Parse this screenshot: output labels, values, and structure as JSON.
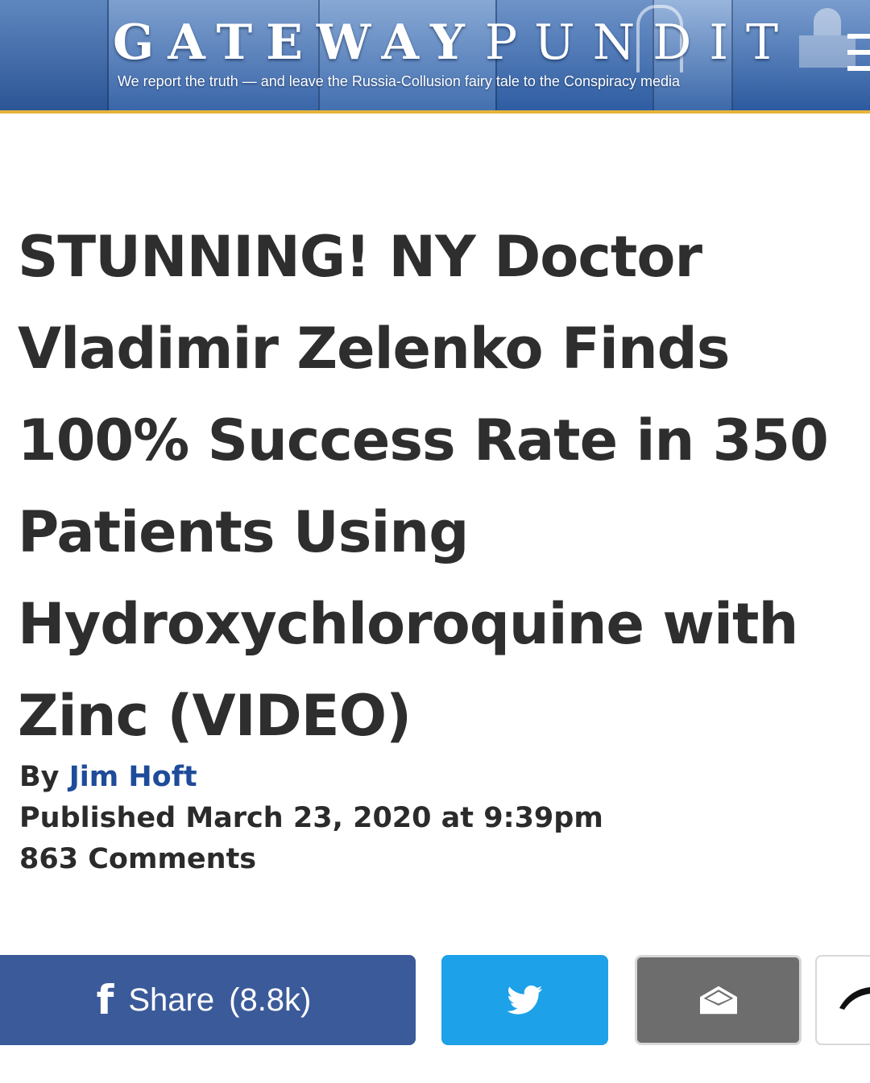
{
  "header": {
    "brand_word1": "GATEWAY",
    "brand_word2": "PUNDIT",
    "tagline": "We report the truth — and leave the Russia-Collusion fairy tale to the Conspiracy media",
    "menu_icon": "hamburger-menu-icon",
    "colors": {
      "banner": "#2a5ca6",
      "accent_border": "#e6b43a"
    }
  },
  "article": {
    "headline": "STUNNING! NY Doctor Vladimir Zelenko Finds 100% Success Rate in 350 Patients Using Hydroxychloroquine with Zinc (VIDEO)",
    "by_label": "By",
    "author": "Jim Hoft",
    "published": "Published March 23, 2020 at 9:39pm",
    "comments": "863 Comments",
    "colors": {
      "text": "#2e2e2e",
      "author_link": "#1e4c9a"
    }
  },
  "share": {
    "facebook": {
      "icon": "facebook-icon",
      "label": "Share",
      "count": "(8.8k)",
      "color": "#3b5a9a"
    },
    "twitter": {
      "icon": "twitter-bird-icon",
      "color": "#1da1e8"
    },
    "email": {
      "icon": "envelope-open-icon",
      "color": "#6d6d6d"
    },
    "more": {
      "icon": "share-arrow-icon"
    }
  }
}
